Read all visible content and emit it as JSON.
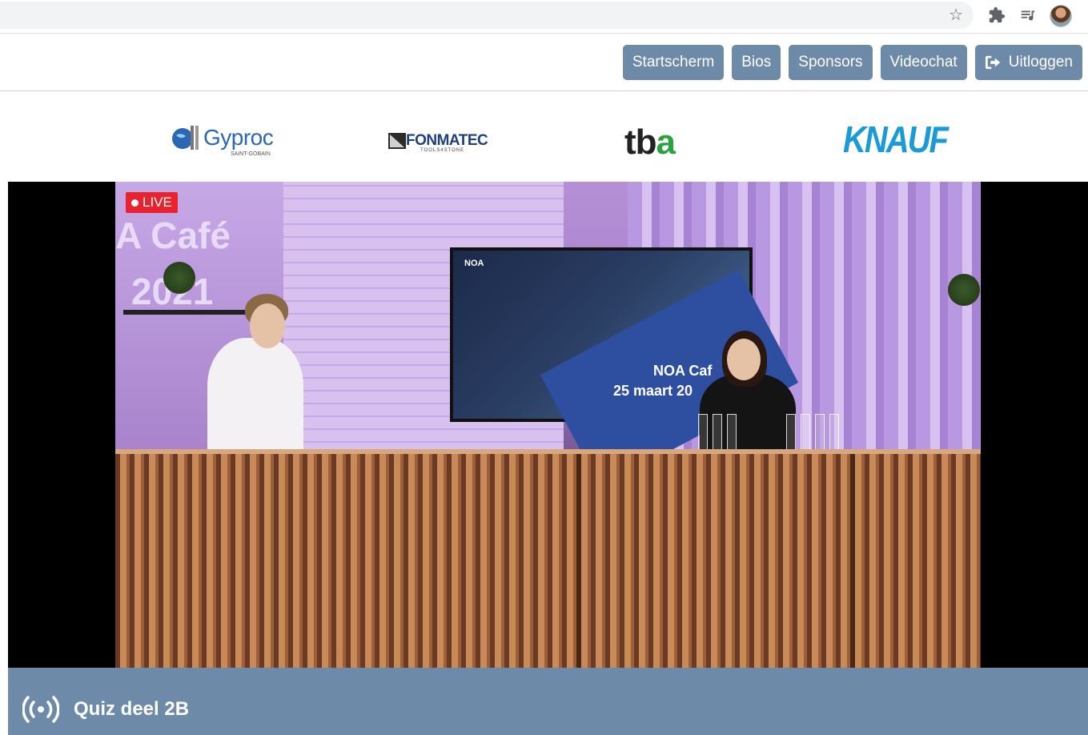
{
  "browser": {
    "star_icon": "star-icon",
    "extensions_icon": "puzzle-icon",
    "media_icon": "playlist-icon"
  },
  "nav": {
    "items": [
      {
        "label": "Startscherm"
      },
      {
        "label": "Bios"
      },
      {
        "label": "Sponsors"
      },
      {
        "label": "Videochat"
      },
      {
        "label": "Uitloggen",
        "icon": "logout-icon"
      }
    ],
    "button_color": "#6d8aa8"
  },
  "sponsors": {
    "gyproc": {
      "name": "Gyproc",
      "sub": "SAINT-GOBAIN"
    },
    "fonmatec": {
      "name": "FONMATEC",
      "sub": "TOOLS4STONE"
    },
    "tba": {
      "name_t": "tb",
      "name_a": "a"
    },
    "knauf": {
      "name": "KNAUF"
    }
  },
  "video": {
    "live_label": "LIVE",
    "live_color": "#e8232f",
    "scene": {
      "background_text_1": "A Café",
      "background_text_2": "2021",
      "tv_brand": "NOA",
      "tv_title": "NOA Caf",
      "tv_date": "25 maart 20"
    }
  },
  "now_playing": {
    "title": "Quiz deel 2B",
    "icon": "broadcast-icon"
  }
}
